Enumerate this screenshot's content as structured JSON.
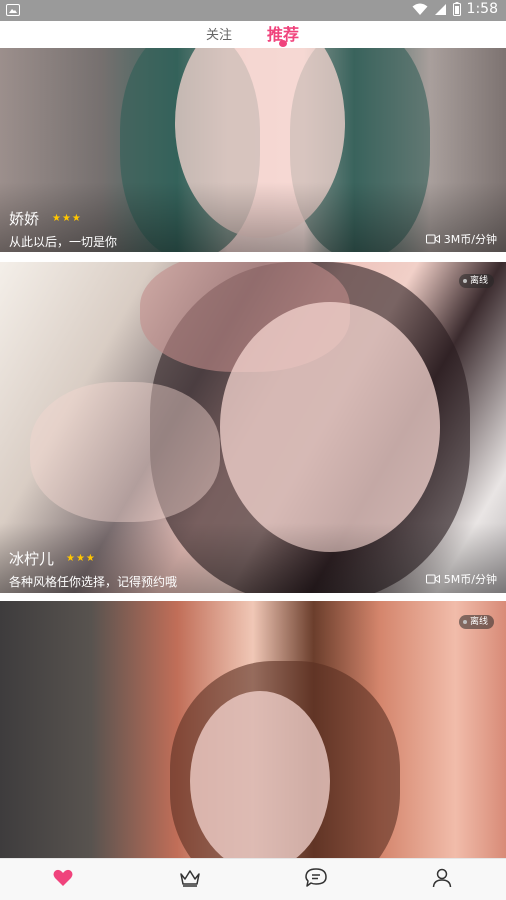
{
  "status_bar": {
    "notification_icon": "image-icon",
    "time": "1:58",
    "icons": [
      "wifi-icon",
      "signal-icon",
      "battery-icon"
    ]
  },
  "tabs": [
    {
      "label": "关注",
      "active": false
    },
    {
      "label": "推荐",
      "active": true
    }
  ],
  "accent_color": "#f0437c",
  "cards": [
    {
      "name": "娇娇",
      "stars": "★★★",
      "bio": "从此以后，一切是你",
      "price": "3M币/分钟",
      "status": ""
    },
    {
      "name": "冰柠儿",
      "stars": "★★★",
      "bio": "各种风格任你选择，记得预约哦",
      "price": "5M币/分钟",
      "status": "离线"
    },
    {
      "name": "",
      "stars": "",
      "bio": "",
      "price": "",
      "status": "离线"
    }
  ],
  "bottom_nav": [
    {
      "icon": "heart-icon",
      "active": true
    },
    {
      "icon": "crown-icon",
      "active": false
    },
    {
      "icon": "chat-icon",
      "active": false
    },
    {
      "icon": "profile-icon",
      "active": false
    }
  ]
}
